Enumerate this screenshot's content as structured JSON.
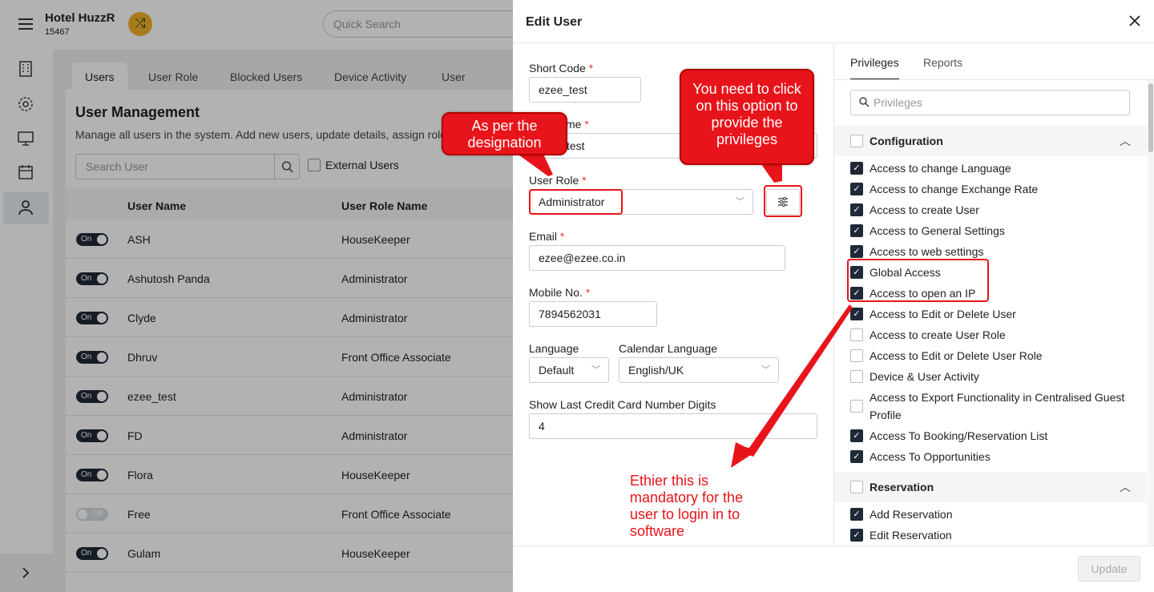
{
  "header": {
    "hotel_name": "Hotel HuzzR",
    "hotel_code": "15467",
    "quick_search_placeholder": "Quick Search"
  },
  "rail": {
    "icons": [
      "menu-icon",
      "building-icon",
      "gear-icon",
      "monitor-icon",
      "calendar-icon",
      "user-icon",
      "chevron-right-icon"
    ],
    "active": "user-icon"
  },
  "main": {
    "tabs": [
      "Users",
      "User Role",
      "Blocked Users",
      "Device Activity",
      "User Activity"
    ],
    "active_tab": "Users",
    "title": "User Management",
    "description": "Manage all users in the system. Add new users, update details, assign role",
    "search_placeholder": "Search User",
    "external_users_label": "External Users",
    "columns": [
      "User Name",
      "User Role Name"
    ],
    "rows": [
      {
        "status": "On",
        "name": "ASH",
        "role": "HouseKeeper"
      },
      {
        "status": "On",
        "name": "Ashutosh Panda",
        "role": "Administrator"
      },
      {
        "status": "On",
        "name": "Clyde",
        "role": "Administrator"
      },
      {
        "status": "On",
        "name": "Dhruv",
        "role": "Front Office Associate"
      },
      {
        "status": "On",
        "name": "ezee_test",
        "role": "Administrator"
      },
      {
        "status": "On",
        "name": "FD",
        "role": "Administrator"
      },
      {
        "status": "On",
        "name": "Flora",
        "role": "HouseKeeper"
      },
      {
        "status": "Off",
        "name": "Free",
        "role": "Front Office Associate"
      },
      {
        "status": "On",
        "name": "Gulam",
        "role": "HouseKeeper"
      }
    ]
  },
  "drawer": {
    "title": "Edit User",
    "short_code_label": "Short Code",
    "short_code_value": "ezee_test",
    "user_name_label_visible": "me",
    "user_name_value_visible": "test",
    "user_role_label": "User Role",
    "user_role_value": "Administrator",
    "email_label": "Email",
    "email_value": "ezee@ezee.co.in",
    "mobile_label": "Mobile No.",
    "mobile_value": "7894562031",
    "language_label": "Language",
    "language_value": "Default",
    "calendar_language_label": "Calendar Language",
    "calendar_language_value": "English/UK",
    "cc_digits_label": "Show Last Credit Card Number Digits",
    "cc_digits_value": "4",
    "required_mark": "*",
    "update_label": "Update"
  },
  "privileges": {
    "tabs": [
      "Privileges",
      "Reports"
    ],
    "active_tab": "Privileges",
    "search_placeholder": "Privileges",
    "sections": [
      {
        "title": "Configuration",
        "checked": false,
        "items": [
          {
            "label": "Access to change Language",
            "checked": true
          },
          {
            "label": "Access to change Exchange Rate",
            "checked": true
          },
          {
            "label": "Access to create User",
            "checked": true
          },
          {
            "label": "Access to General Settings",
            "checked": true
          },
          {
            "label": "Access to web settings",
            "checked": true
          },
          {
            "label": "Global Access",
            "checked": true
          },
          {
            "label": "Access to open an IP",
            "checked": true
          },
          {
            "label": "Access to Edit or Delete User",
            "checked": true
          },
          {
            "label": "Access to create User Role",
            "checked": false
          },
          {
            "label": "Access to Edit or Delete User Role",
            "checked": false
          },
          {
            "label": "Device & User Activity",
            "checked": false
          },
          {
            "label": "Access to Export Functionality in Centralised Guest",
            "label2": "Profile",
            "checked": false
          },
          {
            "label": "Access To Booking/Reservation List",
            "checked": true
          },
          {
            "label": "Access To Opportunities",
            "checked": true
          }
        ]
      },
      {
        "title": "Reservation",
        "checked": false,
        "items": [
          {
            "label": "Add Reservation",
            "checked": true
          },
          {
            "label": "Edit Reservation",
            "checked": true
          }
        ]
      }
    ]
  },
  "annotations": {
    "designation": [
      "As per the",
      "designation"
    ],
    "click_option": [
      "You need to click",
      "on this option to",
      "provide the",
      "privileges"
    ],
    "mandatory": [
      "Ethier this is",
      "mandatory for the",
      "user to login in to",
      "software"
    ],
    "color": "#e8141b"
  }
}
